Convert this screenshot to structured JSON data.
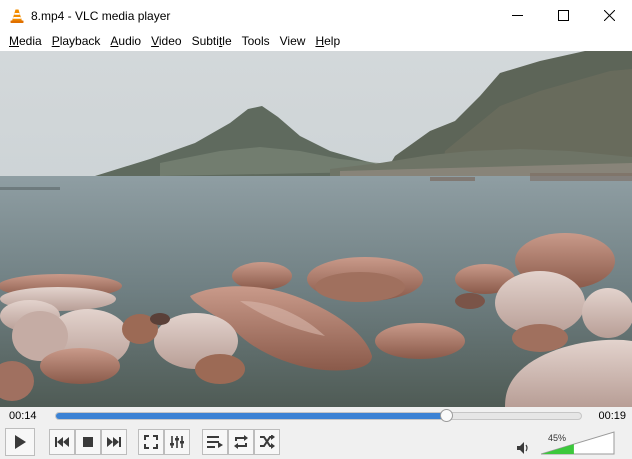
{
  "window": {
    "title": "8.mp4 - VLC media player",
    "minimize_icon": "minimize-icon",
    "maximize_icon": "maximize-icon",
    "close_icon": "close-icon"
  },
  "menu": {
    "items": [
      {
        "mnemonic": "M",
        "rest": "edia"
      },
      {
        "mnemonic": "P",
        "rest": "layback"
      },
      {
        "mnemonic": "A",
        "rest": "udio"
      },
      {
        "mnemonic": "V",
        "rest": "ideo"
      },
      {
        "mnemonic": "",
        "rest": "Subtitle",
        "mnemonic_after": "Subti",
        "mn2": "t",
        "rest2": "le"
      },
      {
        "mnemonic": "",
        "rest": "Tools"
      },
      {
        "mnemonic": "",
        "rest": "View"
      },
      {
        "mnemonic": "H",
        "rest": "elp"
      }
    ],
    "labels": [
      "Media",
      "Playback",
      "Audio",
      "Video",
      "Subtitle",
      "Tools",
      "View",
      "Help"
    ]
  },
  "player": {
    "elapsed": "00:14",
    "total": "00:19",
    "progress": 0.74,
    "volume_label": "45%",
    "volume": 0.45
  },
  "icons": {
    "play": "play-icon",
    "previous": "previous-icon",
    "stop": "stop-icon",
    "next": "next-icon",
    "fullscreen": "fullscreen-icon",
    "extended": "extended-settings-icon",
    "playlist": "playlist-icon",
    "loop": "loop-icon",
    "shuffle": "shuffle-icon",
    "volume": "speaker-icon"
  },
  "colors": {
    "seek_fill": "#3b82d4",
    "volume_fill": "#3cc83c",
    "vlc_orange": "#f28c00"
  }
}
